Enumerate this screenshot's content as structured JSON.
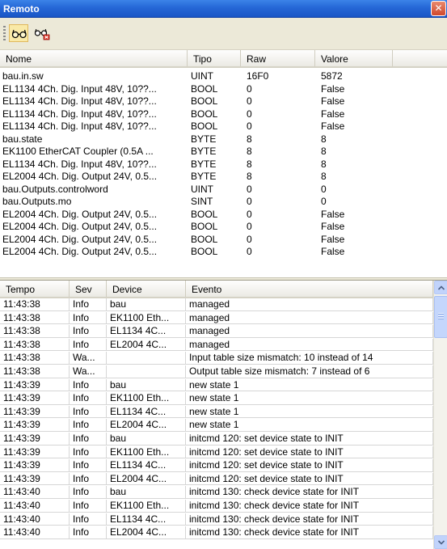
{
  "window": {
    "title": "Remoto",
    "close_glyph": "✕"
  },
  "toolbar": {
    "buttons": [
      {
        "icon": "glasses-icon",
        "active": true
      },
      {
        "icon": "glasses-edit-icon",
        "active": false
      }
    ]
  },
  "vars": {
    "columns": [
      "Nome",
      "Tipo",
      "Raw",
      "Valore"
    ],
    "rows": [
      [
        "bau.in.sw",
        "UINT",
        "16F0",
        "5872"
      ],
      [
        "EL1134 4Ch. Dig. Input 48V, 10??...",
        "BOOL",
        "0",
        "False"
      ],
      [
        "EL1134 4Ch. Dig. Input 48V, 10??...",
        "BOOL",
        "0",
        "False"
      ],
      [
        "EL1134 4Ch. Dig. Input 48V, 10??...",
        "BOOL",
        "0",
        "False"
      ],
      [
        "EL1134 4Ch. Dig. Input 48V, 10??...",
        "BOOL",
        "0",
        "False"
      ],
      [
        "bau.state",
        "BYTE",
        "8",
        "8"
      ],
      [
        "EK1100 EtherCAT Coupler (0.5A ...",
        "BYTE",
        "8",
        "8"
      ],
      [
        "EL1134 4Ch. Dig. Input 48V, 10??...",
        "BYTE",
        "8",
        "8"
      ],
      [
        "EL2004 4Ch. Dig. Output 24V, 0.5...",
        "BYTE",
        "8",
        "8"
      ],
      [
        "bau.Outputs.controlword",
        "UINT",
        "0",
        "0"
      ],
      [
        "bau.Outputs.mo",
        "SINT",
        "0",
        "0"
      ],
      [
        "EL2004 4Ch. Dig. Output 24V, 0.5...",
        "BOOL",
        "0",
        "False"
      ],
      [
        "EL2004 4Ch. Dig. Output 24V, 0.5...",
        "BOOL",
        "0",
        "False"
      ],
      [
        "EL2004 4Ch. Dig. Output 24V, 0.5...",
        "BOOL",
        "0",
        "False"
      ],
      [
        "EL2004 4Ch. Dig. Output 24V, 0.5...",
        "BOOL",
        "0",
        "False"
      ]
    ]
  },
  "log": {
    "columns": [
      "Tempo",
      "Sev",
      "Device",
      "Evento"
    ],
    "rows": [
      [
        "11:43:38",
        "Info",
        "bau",
        "managed"
      ],
      [
        "11:43:38",
        "Info",
        "EK1100 Eth...",
        "managed"
      ],
      [
        "11:43:38",
        "Info",
        "EL1134 4C...",
        "managed"
      ],
      [
        "11:43:38",
        "Info",
        "EL2004 4C...",
        "managed"
      ],
      [
        "11:43:38",
        "Wa...",
        "",
        "Input table size mismatch: 10 instead of 14"
      ],
      [
        "11:43:38",
        "Wa...",
        "",
        "Output table size mismatch: 7 instead of 6"
      ],
      [
        "11:43:39",
        "Info",
        "bau",
        "new state 1"
      ],
      [
        "11:43:39",
        "Info",
        "EK1100 Eth...",
        "new state 1"
      ],
      [
        "11:43:39",
        "Info",
        "EL1134 4C...",
        "new state 1"
      ],
      [
        "11:43:39",
        "Info",
        "EL2004 4C...",
        "new state 1"
      ],
      [
        "11:43:39",
        "Info",
        "bau",
        "initcmd 120: set device state to INIT"
      ],
      [
        "11:43:39",
        "Info",
        "EK1100 Eth...",
        "initcmd 120: set device state to INIT"
      ],
      [
        "11:43:39",
        "Info",
        "EL1134 4C...",
        "initcmd 120: set device state to INIT"
      ],
      [
        "11:43:39",
        "Info",
        "EL2004 4C...",
        "initcmd 120: set device state to INIT"
      ],
      [
        "11:43:40",
        "Info",
        "bau",
        "initcmd 130: check device state for INIT"
      ],
      [
        "11:43:40",
        "Info",
        "EK1100 Eth...",
        "initcmd 130: check device state for INIT"
      ],
      [
        "11:43:40",
        "Info",
        "EL1134 4C...",
        "initcmd 130: check device state for INIT"
      ],
      [
        "11:43:40",
        "Info",
        "EL2004 4C...",
        "initcmd 130: check device state for INIT"
      ]
    ]
  }
}
